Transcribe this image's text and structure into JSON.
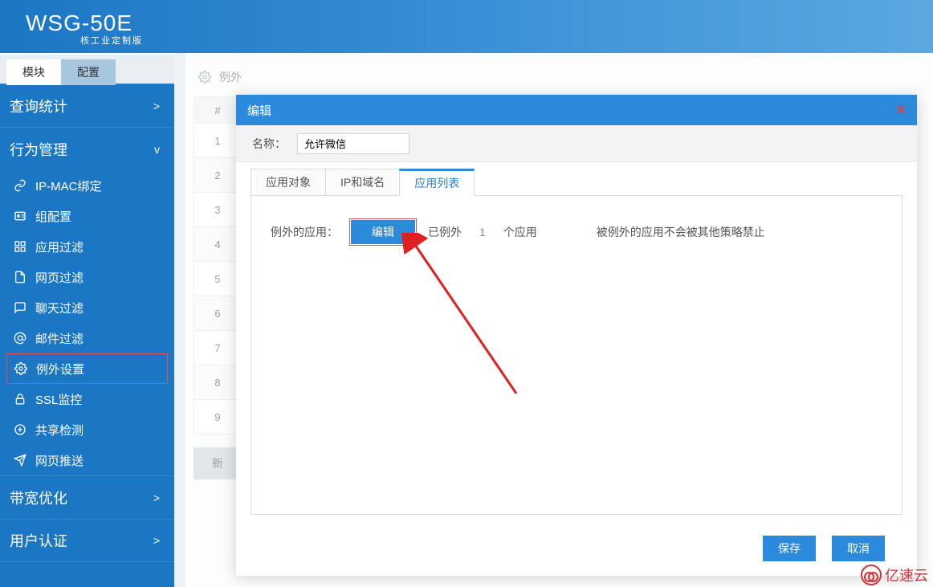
{
  "header": {
    "logo": "WSG-50E",
    "sublogo": "核工业定制版"
  },
  "sidebar": {
    "tabs": {
      "module": "模块",
      "config": "配置"
    },
    "sections": {
      "query": {
        "label": "查询统计",
        "chev": ">"
      },
      "behavior": {
        "label": "行为管理",
        "chev": "v",
        "items": [
          {
            "id": "ipmac",
            "label": "IP-MAC绑定",
            "icon": "link-icon"
          },
          {
            "id": "group",
            "label": "组配置",
            "icon": "id-icon"
          },
          {
            "id": "appfilter",
            "label": "应用过滤",
            "icon": "grid-icon"
          },
          {
            "id": "webfilter",
            "label": "网页过滤",
            "icon": "page-icon"
          },
          {
            "id": "chatfilter",
            "label": "聊天过滤",
            "icon": "chat-icon"
          },
          {
            "id": "mailfilter",
            "label": "邮件过滤",
            "icon": "at-icon"
          },
          {
            "id": "exception",
            "label": "例外设置",
            "icon": "gear-icon",
            "active": true
          },
          {
            "id": "ssl",
            "label": "SSL监控",
            "icon": "lock-icon"
          },
          {
            "id": "share",
            "label": "共享检测",
            "icon": "share-icon"
          },
          {
            "id": "webpush",
            "label": "网页推送",
            "icon": "send-icon"
          }
        ]
      },
      "bandwidth": {
        "label": "带宽优化",
        "chev": ">"
      },
      "userauth": {
        "label": "用户认证",
        "chev": ">"
      }
    }
  },
  "breadcrumb": {
    "text": "例外"
  },
  "table": {
    "head": "#",
    "rows": [
      "1",
      "2",
      "3",
      "4",
      "5",
      "6",
      "7",
      "8",
      "9"
    ],
    "new_btn": "新"
  },
  "modal": {
    "title": "编辑",
    "name_label": "名称：",
    "name_value": "允许微信",
    "tabs": {
      "obj": "应用对象",
      "ipdomain": "IP和域名",
      "applist": "应用列表"
    },
    "app_label": "例外的应用：",
    "edit_btn": "编辑",
    "count_prefix": "已例外",
    "count_num": "1",
    "count_suffix": "个应用",
    "note": "被例外的应用不会被其他策略禁止",
    "save": "保存",
    "cancel": "取消"
  },
  "watermark": {
    "text": "亿速云"
  }
}
